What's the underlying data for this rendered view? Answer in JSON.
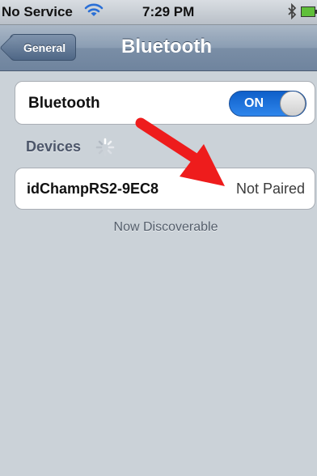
{
  "status_bar": {
    "carrier": "No Service",
    "time": "7:29 PM",
    "icons": [
      "wifi-icon",
      "bluetooth-icon",
      "battery-icon"
    ]
  },
  "nav": {
    "back_label": "General",
    "title": "Bluetooth"
  },
  "bluetooth_setting": {
    "label": "Bluetooth",
    "toggle_label": "ON",
    "toggle_on": true
  },
  "devices": {
    "header": "Devices",
    "items": [
      {
        "name": "idChampRS2-9EC8",
        "status": "Not Paired"
      }
    ],
    "footer": "Now Discoverable"
  },
  "colors": {
    "toggle_on": "#2f86ec",
    "nav_bar": "#7a8ea6",
    "background": "#cbd2d8",
    "annotation_arrow": "#ee1c1c"
  }
}
